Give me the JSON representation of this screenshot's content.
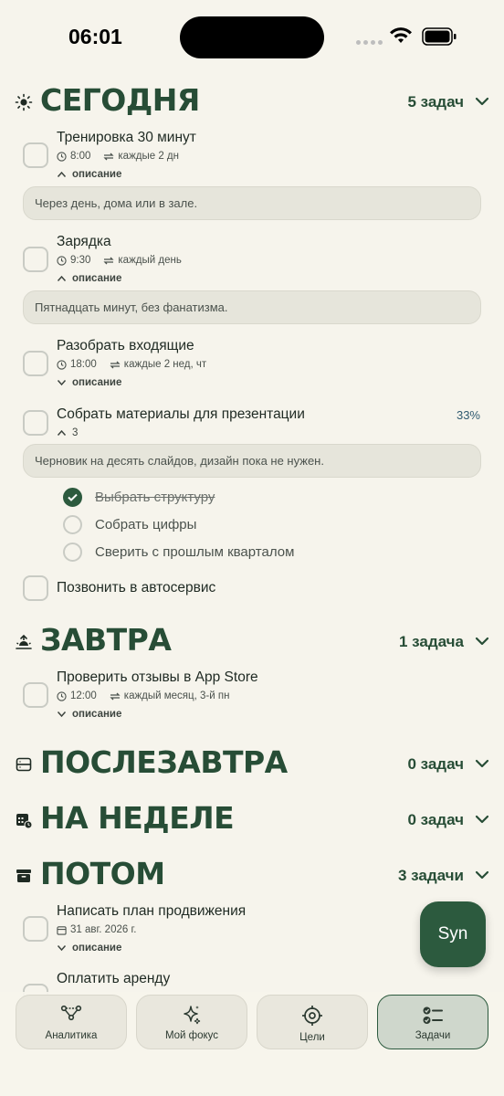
{
  "status": {
    "time": "06:01"
  },
  "sections": {
    "today": {
      "title": "СЕГОДНЯ",
      "count": "5 задач",
      "tasks": [
        {
          "title": "Тренировка 30 минут",
          "time": "8:00",
          "repeat": "каждые 2 дн",
          "toggle": "описание",
          "note": "Через день, дома или в зале."
        },
        {
          "title": "Зарядка",
          "time": "9:30",
          "repeat": "каждый день",
          "toggle": "описание",
          "note": "Пятнадцать минут, без фанатизма."
        },
        {
          "title": "Разобрать входящие",
          "time": "18:00",
          "repeat": "каждые 2 нед, чт",
          "toggle": "описание"
        },
        {
          "title": "Собрать материалы для презентации",
          "percent": "33%",
          "toggle": "3",
          "note": "Черновик на десять слайдов, дизайн пока не нужен.",
          "subtasks": [
            {
              "label": "Выбрать структуру",
              "done": true
            },
            {
              "label": "Собрать цифры",
              "done": false
            },
            {
              "label": "Сверить с прошлым кварталом",
              "done": false
            }
          ]
        },
        {
          "title": "Позвонить в автосервис"
        }
      ]
    },
    "tomorrow": {
      "title": "ЗАВТРА",
      "count": "1 задача",
      "tasks": [
        {
          "title": "Проверить отзывы в App Store",
          "time": "12:00",
          "repeat": "каждый месяц, 3-й пн",
          "toggle": "описание"
        }
      ]
    },
    "day_after": {
      "title": "ПОСЛЕЗАВТРА",
      "count": "0 задач"
    },
    "week": {
      "title": "НА НЕДЕЛЕ",
      "count": "0 задач"
    },
    "later": {
      "title": "ПОТОМ",
      "count": "3 задачи",
      "tasks": [
        {
          "title": "Написать план продвижения",
          "date": "31 авг. 2026 г.",
          "toggle": "описание"
        },
        {
          "title": "Оплатить аренду"
        }
      ]
    }
  },
  "fab": {
    "label": "Syn"
  },
  "tabs": [
    {
      "label": "Аналитика",
      "icon": "analytics-icon"
    },
    {
      "label": "Мой фокус",
      "icon": "sparkles-icon"
    },
    {
      "label": "Цели",
      "icon": "target-icon"
    },
    {
      "label": "Задачи",
      "icon": "checklist-icon",
      "active": true
    }
  ],
  "colors": {
    "accent": "#274d36",
    "background": "#f6f4ec",
    "percent": "#2f5a70"
  }
}
